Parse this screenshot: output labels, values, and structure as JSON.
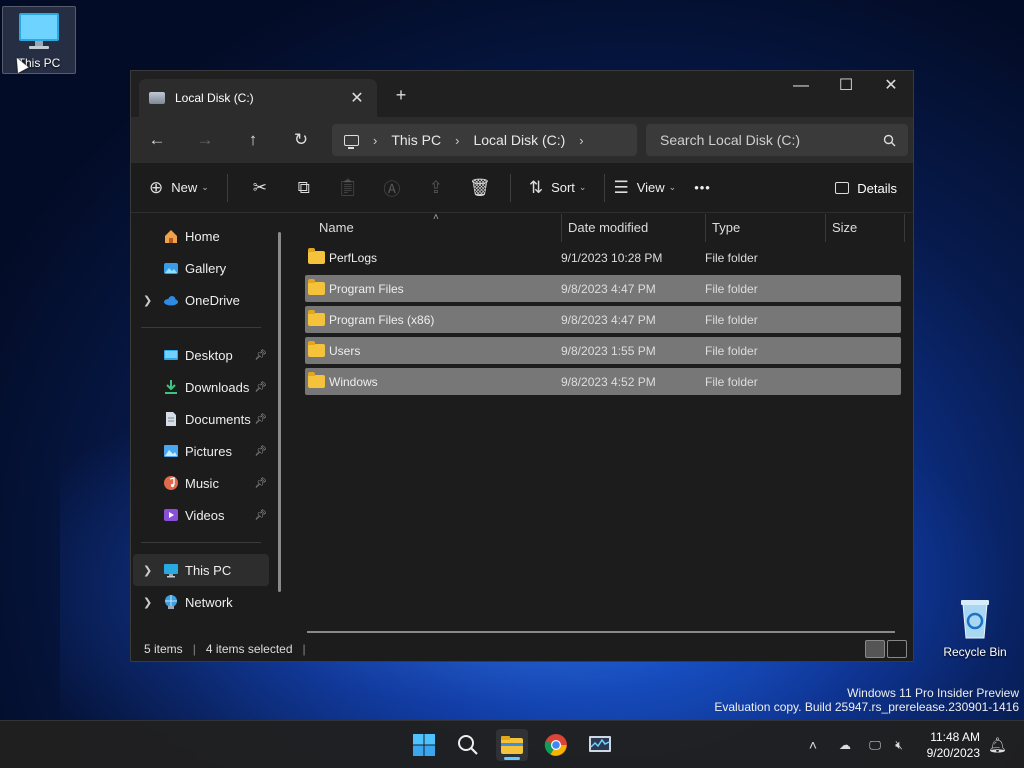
{
  "desktop": {
    "icons": [
      {
        "label": "This PC",
        "icon": "this-pc-icon"
      },
      {
        "label": "Recycle Bin",
        "icon": "recycle-bin-icon"
      }
    ],
    "watermark": {
      "line1": "Windows 11 Pro Insider Preview",
      "line2": "Evaluation copy. Build 25947.rs_prerelease.230901-1416"
    }
  },
  "window": {
    "tab_title": "Local Disk (C:)",
    "tab_close": "✕",
    "new_tab": "+",
    "controls": {
      "minimize": "—",
      "maximize": "☐",
      "close": "✕"
    },
    "nav": {
      "back": "←",
      "forward": "→",
      "up": "↑",
      "refresh": "↻"
    },
    "breadcrumb": [
      "This PC",
      "Local Disk (C:)"
    ],
    "breadcrumb_sep": "›",
    "search_placeholder": "Search Local Disk (C:)",
    "commands": {
      "new": "New",
      "sort": "Sort",
      "view": "View",
      "more": "•••",
      "details": "Details"
    },
    "sidebar": {
      "top": [
        {
          "label": "Home",
          "icon": "home-icon"
        },
        {
          "label": "Gallery",
          "icon": "gallery-icon"
        },
        {
          "label": "OneDrive",
          "icon": "onedrive-icon"
        }
      ],
      "pinned": [
        {
          "label": "Desktop",
          "icon": "desktop-folder-icon"
        },
        {
          "label": "Downloads",
          "icon": "downloads-icon"
        },
        {
          "label": "Documents",
          "icon": "documents-icon"
        },
        {
          "label": "Pictures",
          "icon": "pictures-icon"
        },
        {
          "label": "Music",
          "icon": "music-icon"
        },
        {
          "label": "Videos",
          "icon": "videos-icon"
        }
      ],
      "bottom": [
        {
          "label": "This PC",
          "icon": "this-pc-icon",
          "selected": true
        },
        {
          "label": "Network",
          "icon": "network-icon"
        }
      ]
    },
    "columns": {
      "name": "Name",
      "date": "Date modified",
      "type": "Type",
      "size": "Size"
    },
    "files": [
      {
        "name": "PerfLogs",
        "date": "9/1/2023 10:28 PM",
        "type": "File folder",
        "selected": false
      },
      {
        "name": "Program Files",
        "date": "9/8/2023 4:47 PM",
        "type": "File folder",
        "selected": true
      },
      {
        "name": "Program Files (x86)",
        "date": "9/8/2023 4:47 PM",
        "type": "File folder",
        "selected": true
      },
      {
        "name": "Users",
        "date": "9/8/2023 1:55 PM",
        "type": "File folder",
        "selected": true
      },
      {
        "name": "Windows",
        "date": "9/8/2023 4:52 PM",
        "type": "File folder",
        "selected": true
      }
    ],
    "status": {
      "items": "5 items",
      "selected": "4 items selected"
    }
  },
  "taskbar": {
    "apps": [
      "start-icon",
      "search-icon",
      "file-explorer-icon",
      "chrome-icon",
      "resource-monitor-icon"
    ],
    "clock": {
      "time": "11:48 AM",
      "date": "9/20/2023"
    }
  },
  "colors": {
    "accent": "#60cdff",
    "selection": "#777777",
    "folder": "#f5c23b"
  }
}
